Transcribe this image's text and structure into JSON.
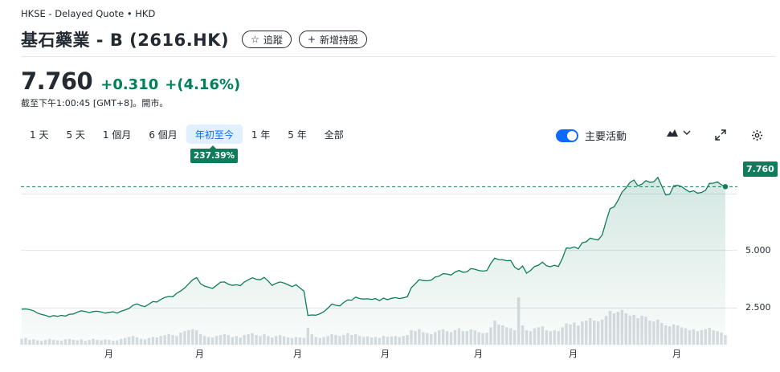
{
  "header": {
    "exchange_line": "HKSE - Delayed Quote • HKD",
    "title": "基石藥業 - B (2616.HK)",
    "follow_label": "追蹤",
    "add_holding_label": "新增持股"
  },
  "quote": {
    "price": "7.760",
    "change": "+0.310",
    "change_pct": "+(4.16%)",
    "timestamp": "截至下午1:00:45 [GMT+8]。開市。"
  },
  "ranges": [
    "1 天",
    "5 天",
    "1 個月",
    "6 個月",
    "年初至今",
    "1 年",
    "5 年",
    "全部"
  ],
  "active_range": "年初至今",
  "ytd_return": "237.39%",
  "controls": {
    "key_events_label": "主要活動",
    "key_events_on": true,
    "chart_type_icon": "mountain-chart-icon",
    "expand_icon": "expand-icon",
    "settings_icon": "gear-icon"
  },
  "colors": {
    "positive": "#008059",
    "tag": "#0f7c5c",
    "accent": "#0f69ff",
    "line": "#0f7c5c"
  },
  "chart_data": {
    "type": "area",
    "title": "",
    "ylabel": "",
    "xlabel": "",
    "y_ticks": [
      "5.000",
      "2.500"
    ],
    "y_tick_values": [
      5.0,
      2.5
    ],
    "ylim": [
      0.98,
      9.06
    ],
    "current_price_label": "7.760",
    "current_price": 7.76,
    "x_month_labels": [
      "月",
      "月",
      "月",
      "月",
      "月",
      "月",
      "月"
    ],
    "grid": true,
    "series": [
      {
        "values": [
          2.45,
          2.46,
          2.43,
          2.38,
          2.28,
          2.22,
          2.18,
          2.12,
          2.17,
          2.14,
          2.18,
          2.15,
          2.23,
          2.24,
          2.32,
          2.38,
          2.35,
          2.3,
          2.35,
          2.36,
          2.33,
          2.28,
          2.31,
          2.34,
          2.28,
          2.36,
          2.42,
          2.48,
          2.62,
          2.68,
          2.6,
          2.56,
          2.67,
          2.78,
          2.76,
          2.87,
          2.96,
          3.0,
          2.99,
          3.14,
          3.24,
          3.37,
          3.55,
          3.72,
          3.82,
          3.55,
          3.45,
          3.4,
          3.35,
          3.48,
          3.62,
          3.63,
          3.53,
          3.48,
          3.51,
          3.47,
          3.63,
          3.72,
          3.81,
          3.75,
          3.72,
          3.83,
          3.67,
          3.48,
          3.57,
          3.63,
          3.58,
          3.51,
          3.43,
          3.51,
          3.37,
          3.23,
          2.18,
          2.2,
          2.19,
          2.25,
          2.34,
          2.49,
          2.67,
          2.62,
          2.59,
          2.74,
          2.85,
          2.84,
          2.97,
          2.91,
          2.89,
          2.9,
          2.87,
          2.91,
          2.82,
          2.93,
          2.86,
          2.92,
          2.95,
          2.91,
          2.94,
          2.99,
          3.38,
          3.55,
          3.73,
          3.69,
          3.68,
          3.71,
          3.84,
          3.88,
          3.99,
          3.97,
          3.93,
          4.06,
          4.13,
          4.05,
          4.07,
          4.21,
          4.18,
          4.12,
          4.1,
          4.12,
          4.43,
          4.66,
          4.6,
          4.59,
          4.55,
          4.56,
          4.27,
          4.16,
          4.32,
          4.01,
          4.13,
          4.3,
          4.36,
          4.49,
          4.33,
          4.29,
          4.35,
          4.3,
          4.65,
          5.1,
          5.09,
          5.15,
          5.07,
          5.33,
          5.37,
          5.53,
          5.48,
          5.45,
          5.66,
          6.26,
          6.81,
          6.88,
          7.17,
          7.52,
          7.71,
          7.94,
          8.05,
          7.8,
          7.87,
          8.02,
          7.95,
          7.97,
          8.16,
          7.79,
          7.4,
          7.43,
          7.8,
          7.82,
          7.76,
          7.64,
          7.53,
          7.58,
          7.48,
          7.51,
          7.6,
          7.9,
          7.91,
          7.97,
          7.84,
          7.76
        ]
      }
    ],
    "volume_relative": [
      0.12,
      0.14,
      0.1,
      0.11,
      0.09,
      0.08,
      0.1,
      0.12,
      0.1,
      0.09,
      0.08,
      0.11,
      0.12,
      0.1,
      0.09,
      0.11,
      0.08,
      0.1,
      0.12,
      0.1,
      0.09,
      0.11,
      0.1,
      0.08,
      0.09,
      0.12,
      0.14,
      0.16,
      0.18,
      0.15,
      0.12,
      0.11,
      0.14,
      0.16,
      0.15,
      0.18,
      0.2,
      0.22,
      0.2,
      0.18,
      0.25,
      0.28,
      0.3,
      0.32,
      0.3,
      0.22,
      0.18,
      0.16,
      0.15,
      0.18,
      0.2,
      0.22,
      0.2,
      0.16,
      0.18,
      0.15,
      0.2,
      0.22,
      0.24,
      0.2,
      0.18,
      0.22,
      0.18,
      0.15,
      0.18,
      0.2,
      0.17,
      0.15,
      0.14,
      0.16,
      0.15,
      0.14,
      0.35,
      0.22,
      0.16,
      0.14,
      0.16,
      0.18,
      0.22,
      0.2,
      0.18,
      0.2,
      0.24,
      0.2,
      0.22,
      0.18,
      0.16,
      0.17,
      0.15,
      0.16,
      0.14,
      0.18,
      0.16,
      0.17,
      0.18,
      0.16,
      0.18,
      0.2,
      0.3,
      0.28,
      0.32,
      0.26,
      0.24,
      0.22,
      0.26,
      0.3,
      0.32,
      0.28,
      0.26,
      0.3,
      0.34,
      0.28,
      0.28,
      0.32,
      0.3,
      0.26,
      0.24,
      0.25,
      0.36,
      0.5,
      0.42,
      0.4,
      0.36,
      0.34,
      0.3,
      0.98,
      0.4,
      0.3,
      0.28,
      0.34,
      0.36,
      0.38,
      0.3,
      0.28,
      0.3,
      0.28,
      0.36,
      0.44,
      0.42,
      0.46,
      0.4,
      0.48,
      0.5,
      0.55,
      0.5,
      0.48,
      0.52,
      0.6,
      0.7,
      0.65,
      0.68,
      0.72,
      0.65,
      0.6,
      0.62,
      0.55,
      0.6,
      0.58,
      0.5,
      0.48,
      0.52,
      0.45,
      0.4,
      0.38,
      0.42,
      0.4,
      0.36,
      0.34,
      0.3,
      0.32,
      0.28,
      0.3,
      0.32,
      0.35,
      0.3,
      0.28,
      0.25,
      0.2
    ]
  }
}
